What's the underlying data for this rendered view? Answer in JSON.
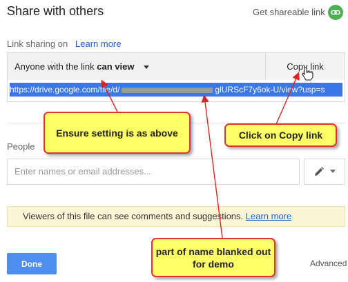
{
  "dialog": {
    "title": "Share with others",
    "get_link_label": "Get shareable link",
    "link_icon": "link-icon"
  },
  "link_sharing": {
    "label": "Link sharing on",
    "learn_more": "Learn more",
    "dropdown_prefix": "Anyone with the link ",
    "dropdown_bold": "can view",
    "copy_link": "Copy link",
    "url_prefix": "https://drive.google.com/file/d/",
    "url_suffix": "glURScF7y6ok-U/view?usp=s"
  },
  "people": {
    "label": "People",
    "placeholder": "Enter names or email addresses..."
  },
  "notice": {
    "text": "Viewers of this file can see comments and suggestions. ",
    "link": "Learn more"
  },
  "footer": {
    "done": "Done",
    "advanced": "Advanced"
  },
  "annotations": {
    "setting": "Ensure setting is as above",
    "copy": "Click on Copy link",
    "blanked": "part of name blanked out for demo"
  },
  "colors": {
    "accent_blue": "#4d8ef0",
    "link_green": "#4caf50",
    "callout_fill": "#ffff66",
    "arrow_red": "#dd2222"
  }
}
